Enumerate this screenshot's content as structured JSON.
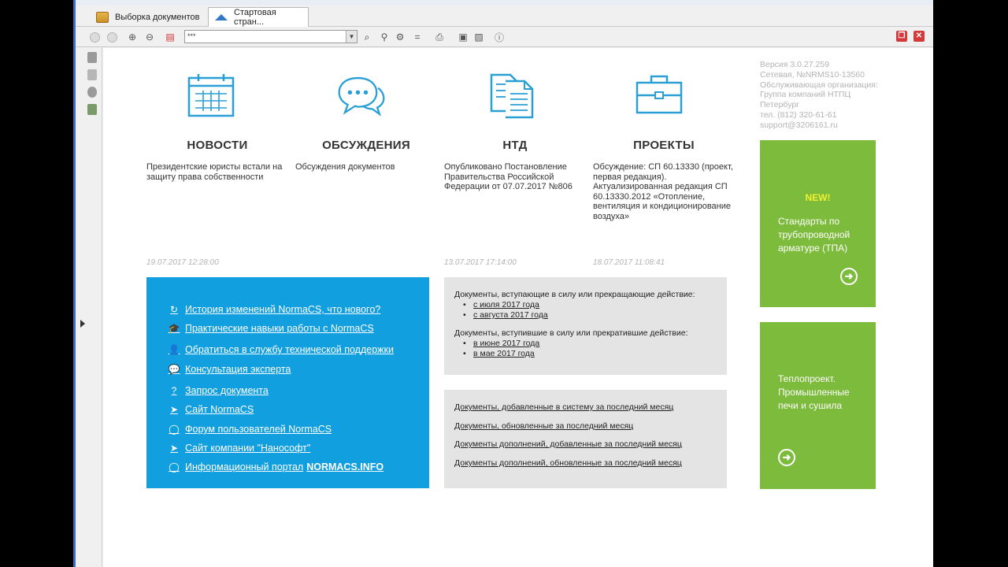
{
  "tabs": [
    {
      "label": "Выборка документов"
    },
    {
      "label": "Стартовая стран..."
    }
  ],
  "toolbar": {
    "combo_value": "***"
  },
  "features": [
    {
      "title": "НОВОСТИ",
      "desc": "Президентские юристы встали на защиту права собственности",
      "date": "19.07.2017 12:28:00",
      "icon": "calendar-icon"
    },
    {
      "title": "ОБСУЖДЕНИЯ",
      "desc": "Обсуждения документов",
      "date": "",
      "icon": "chat-bubbles-icon"
    },
    {
      "title": "НТД",
      "desc": "Опубликовано Постановление Правительства Российской Федерации от 07.07.2017 №806",
      "date": "13.07.2017 17:14:00",
      "icon": "documents-icon"
    },
    {
      "title": "ПРОЕКТЫ",
      "desc": "Обсуждение: СП 60.13330 (проект, первая редакция). Актуализированная редакция СП 60.13330.2012 «Отопление, вентиляция и кондиционирование воздуха»",
      "date": "18.07.2017 11:08:41",
      "icon": "briefcase-icon"
    }
  ],
  "blue_links": [
    {
      "icon": "history-icon",
      "glyph": "↻",
      "label": "История изменений NormaCS, что нового?",
      "bold": ""
    },
    {
      "icon": "graduation-cap-icon",
      "glyph": "🎓",
      "label": "Практические навыки работы с NormaCS",
      "bold": ""
    },
    {
      "icon": "user-icon",
      "glyph": "👤",
      "label": "Обратиться в службу технической поддержки",
      "bold": ""
    },
    {
      "icon": "chat-icon",
      "glyph": "💬",
      "label": "Консультация эксперта",
      "bold": ""
    },
    {
      "icon": "document-request-icon",
      "glyph": "?",
      "label": "Запрос документа",
      "bold": ""
    },
    {
      "icon": "send-icon",
      "glyph": "➤",
      "label": "Сайт NormaCS",
      "bold": ""
    },
    {
      "icon": "forum-icon",
      "glyph": "◯",
      "label": "Форум пользователей NormaCS",
      "bold": ""
    },
    {
      "icon": "send-icon",
      "glyph": "➤",
      "label": "Сайт компании \"Нанософт\"",
      "bold": ""
    },
    {
      "icon": "forum-icon",
      "glyph": "◯",
      "label": "Информационный портал",
      "bold": "NORMACS.INFO"
    }
  ],
  "panel_changes": {
    "intro_1": "Документы, вступающие в силу или прекращающие действие:",
    "items_1": [
      "с июля 2017 года",
      "с августа 2017 года"
    ],
    "intro_2": "Документы, вступившие в силу или прекратившие действие:",
    "items_2": [
      "в июне 2017 года",
      "в мае 2017 года"
    ]
  },
  "panel_docs": [
    "Документы, добавленные в систему за последний месяц",
    "Документы, обновленные за последний месяц",
    "Документы дополнений, добавленные за последний месяц",
    "Документы дополнений, обновленные за последний месяц"
  ],
  "version": {
    "line1": "Версия 3.0.27.259",
    "line2": "Сетевая, №NRMS10-13560",
    "line3": "Обслуживающая организация:",
    "line4": "Группа компаний НТПЦ",
    "line5": "Петербург",
    "line6": "тел. (812) 320-61-61",
    "line7": "support@3206161.ru"
  },
  "promo1": {
    "badge": "NEW!",
    "text": "Стандарты по трубопроводной арматуре (ТПА)"
  },
  "promo2": {
    "text": "Теплопроект. Промышленные печи и сушила"
  },
  "colors": {
    "blue_panel": "#129fe0",
    "green_panel": "#7dbb3c",
    "accent_icon": "#2a9fd6"
  }
}
